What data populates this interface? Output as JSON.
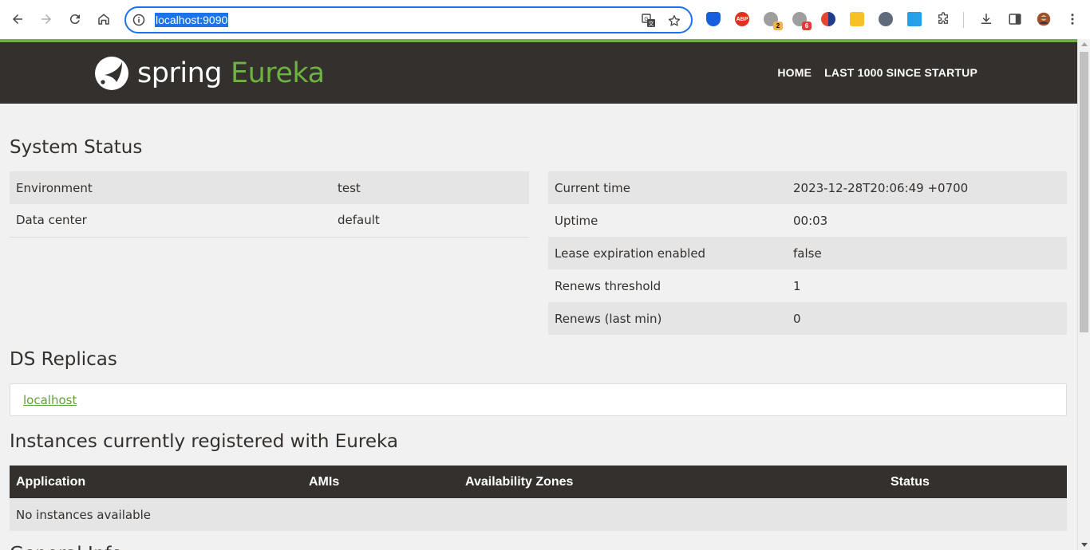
{
  "browser": {
    "url": "localhost:9090",
    "extensions": [
      "bitwarden-icon",
      "adblock-plus-icon",
      "extension-badge-icon",
      "extension-badge-icon",
      "theme-icon",
      "notes-icon",
      "cursor-icon",
      "window-icon",
      "puzzle-icon"
    ],
    "badges": {
      "ext3": "2",
      "ext4": "6"
    }
  },
  "navbar": {
    "logo_word": "spring",
    "logo_product": "Eureka",
    "links": [
      "HOME",
      "LAST 1000 SINCE STARTUP"
    ]
  },
  "system_status": {
    "title": "System Status",
    "left": [
      {
        "key": "Environment",
        "value": "test"
      },
      {
        "key": "Data center",
        "value": "default"
      }
    ],
    "right": [
      {
        "key": "Current time",
        "value": "2023-12-28T20:06:49 +0700"
      },
      {
        "key": "Uptime",
        "value": "00:03"
      },
      {
        "key": "Lease expiration enabled",
        "value": "false"
      },
      {
        "key": "Renews threshold",
        "value": "1"
      },
      {
        "key": "Renews (last min)",
        "value": "0"
      }
    ]
  },
  "replicas": {
    "title": "DS Replicas",
    "items": [
      "localhost"
    ]
  },
  "instances": {
    "title": "Instances currently registered with Eureka",
    "columns": [
      "Application",
      "AMIs",
      "Availability Zones",
      "Status"
    ],
    "empty_text": "No instances available"
  },
  "general_info": {
    "title": "General Info"
  },
  "colors": {
    "spring_green": "#6db33f",
    "navbar_bg": "#34302d",
    "link_green": "#5fa134",
    "page_bg": "#f1f1f1"
  }
}
